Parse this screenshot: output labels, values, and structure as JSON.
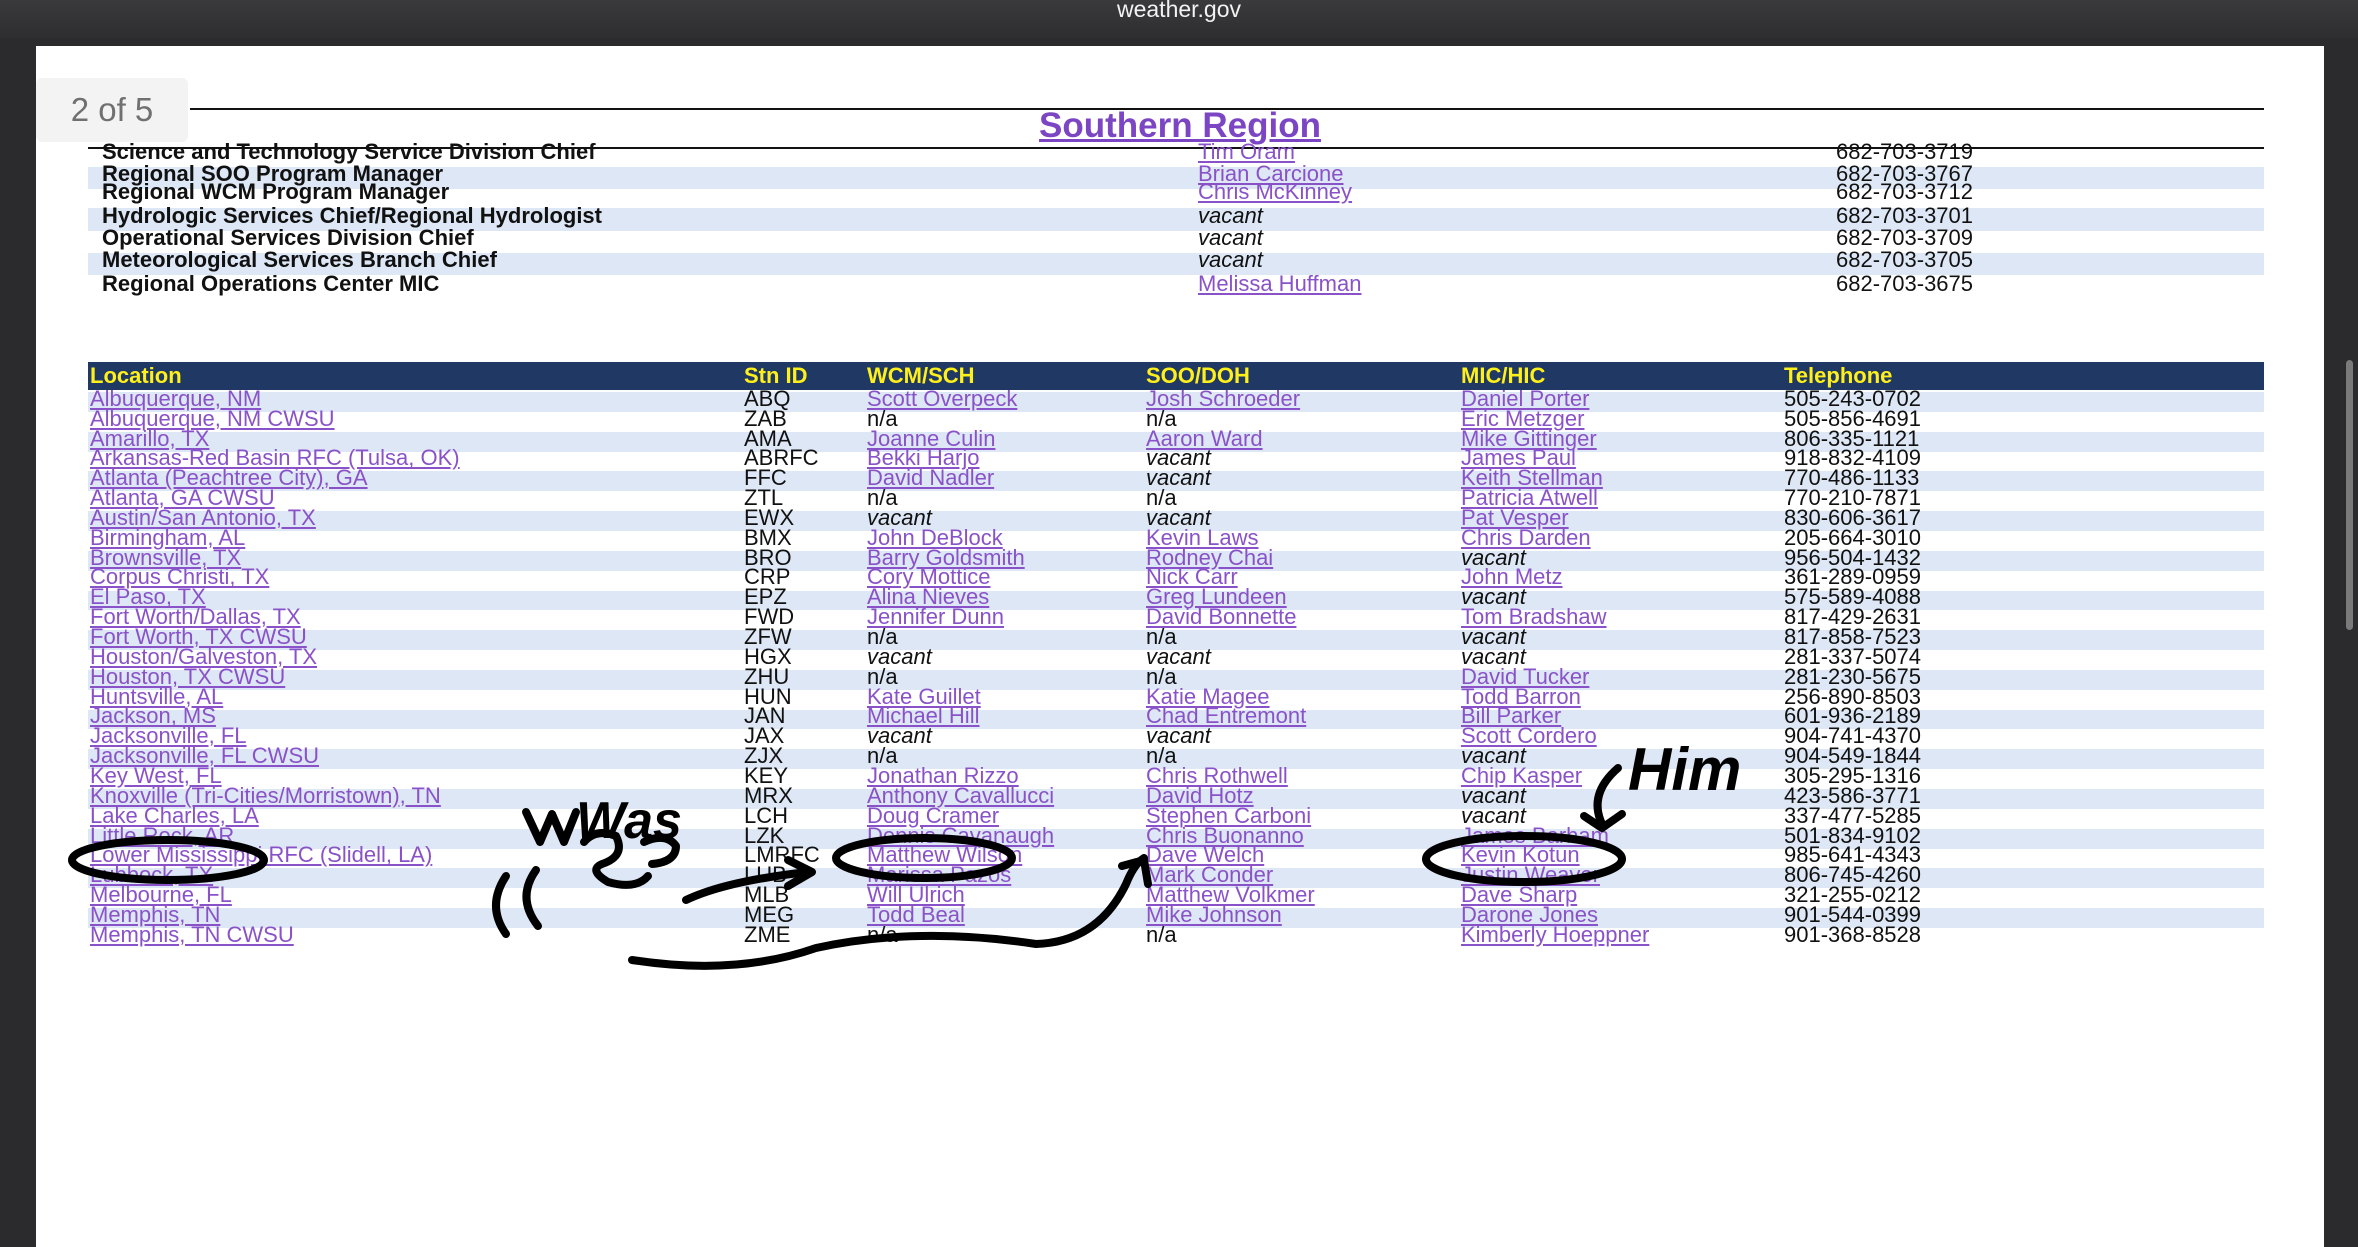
{
  "window": {
    "title": "weather.gov"
  },
  "document": {
    "page_indicator": "2 of 5",
    "region_title": "Southern Region"
  },
  "colors": {
    "link": "#8a52c8",
    "header_bg": "#1f3864",
    "header_text": "#ffef1a",
    "row_shade": "#dde7f5",
    "title": "#7b45c3",
    "annotation_ink": "#000000"
  },
  "staff": [
    {
      "title": "Science and Technology Service Division Chief",
      "name": "Tim Oram",
      "phone": "682-703-3719"
    },
    {
      "title": "Regional SOO Program Manager",
      "name": "Brian Carcione",
      "phone": "682-703-3767"
    },
    {
      "title": "Regional WCM Program Manager",
      "name": "Chris McKinney",
      "phone": "682-703-3712"
    },
    {
      "title": "Hydrologic Services Chief/Regional Hydrologist",
      "name": "vacant",
      "phone": "682-703-3701"
    },
    {
      "title": "Operational Services Division Chief",
      "name": "vacant",
      "phone": "682-703-3709"
    },
    {
      "title": "Meteorological Services Branch Chief",
      "name": "vacant",
      "phone": "682-703-3705"
    },
    {
      "title": "Regional Operations Center MIC",
      "name": "Melissa Huffman",
      "phone": "682-703-3675"
    }
  ],
  "table": {
    "headers": [
      "Location",
      "Stn ID",
      "WCM/SCH",
      "SOO/DOH",
      "MIC/HIC",
      "Telephone"
    ],
    "rows": [
      [
        "Albuquerque, NM",
        "ABQ",
        "Scott Overpeck",
        "Josh Schroeder",
        "Daniel Porter",
        "505-243-0702"
      ],
      [
        "Albuquerque, NM CWSU",
        "ZAB",
        "n/a",
        "n/a",
        "Eric Metzger",
        "505-856-4691"
      ],
      [
        "Amarillo, TX",
        "AMA",
        "Joanne Culin",
        "Aaron Ward",
        "Mike Gittinger",
        "806-335-1121"
      ],
      [
        "Arkansas-Red Basin RFC (Tulsa, OK)",
        "ABRFC",
        "Bekki Harjo",
        "vacant",
        "James Paul",
        "918-832-4109"
      ],
      [
        "Atlanta (Peachtree City), GA",
        "FFC",
        "David Nadler",
        "vacant",
        "Keith Stellman",
        "770-486-1133"
      ],
      [
        "Atlanta, GA CWSU",
        "ZTL",
        "n/a",
        "n/a",
        "Patricia Atwell",
        "770-210-7871"
      ],
      [
        "Austin/San Antonio, TX",
        "EWX",
        "vacant",
        "vacant",
        "Pat Vesper",
        "830-606-3617"
      ],
      [
        "Birmingham, AL",
        "BMX",
        "John DeBlock",
        "Kevin Laws",
        "Chris Darden",
        "205-664-3010"
      ],
      [
        "Brownsville, TX",
        "BRO",
        "Barry Goldsmith",
        "Rodney Chai",
        "vacant",
        "956-504-1432"
      ],
      [
        "Corpus Christi, TX",
        "CRP",
        "Cory Mottice",
        "Nick Carr",
        "John Metz",
        "361-289-0959"
      ],
      [
        "El Paso, TX",
        "EPZ",
        "Alina Nieves",
        "Greg Lundeen",
        "vacant",
        "575-589-4088"
      ],
      [
        "Fort Worth/Dallas, TX",
        "FWD",
        "Jennifer Dunn",
        "David Bonnette",
        "Tom Bradshaw",
        "817-429-2631"
      ],
      [
        "Fort Worth, TX CWSU",
        "ZFW",
        "n/a",
        "n/a",
        "vacant",
        "817-858-7523"
      ],
      [
        "Houston/Galveston, TX",
        "HGX",
        "vacant",
        "vacant",
        "vacant",
        "281-337-5074"
      ],
      [
        "Houston, TX CWSU",
        "ZHU",
        "n/a",
        "n/a",
        "David Tucker",
        "281-230-5675"
      ],
      [
        "Huntsville, AL",
        "HUN",
        "Kate Guillet",
        "Katie Magee",
        "Todd Barron",
        "256-890-8503"
      ],
      [
        "Jackson, MS",
        "JAN",
        "Michael Hill",
        "Chad Entremont",
        "Bill Parker",
        "601-936-2189"
      ],
      [
        "Jacksonville, FL",
        "JAX",
        "vacant",
        "vacant",
        "Scott Cordero",
        "904-741-4370"
      ],
      [
        "Jacksonville, FL CWSU",
        "ZJX",
        "n/a",
        "n/a",
        "vacant",
        "904-549-1844"
      ],
      [
        "Key West, FL",
        "KEY",
        "Jonathan Rizzo",
        "Chris Rothwell",
        "Chip Kasper",
        "305-295-1316"
      ],
      [
        "Knoxville (Tri-Cities/Morristown), TN",
        "MRX",
        "Anthony Cavallucci",
        "David Hotz",
        "vacant",
        "423-586-3771"
      ],
      [
        "Lake Charles, LA",
        "LCH",
        "Doug Cramer",
        "Stephen Carboni",
        "vacant",
        "337-477-5285"
      ],
      [
        "Little Rock, AR",
        "LZK",
        "Dennis Cavanaugh",
        "Chris Buonanno",
        "James Barham",
        "501-834-9102"
      ],
      [
        "Lower Mississippi RFC (Slidell, LA)",
        "LMRFC",
        "Matthew Wilson",
        "Dave Welch",
        "Kevin Kotun",
        "985-641-4343"
      ],
      [
        "Lubbock, TX",
        "LUB",
        "Marissa Pazos",
        "Mark Conder",
        "Justin Weaver",
        "806-745-4260"
      ],
      [
        "Melbourne, FL",
        "MLB",
        "Will Ulrich",
        "Matthew Volkmer",
        "Dave Sharp",
        "321-255-0212"
      ],
      [
        "Memphis, TN",
        "MEG",
        "Todd Beal",
        "Mike Johnson",
        "Darone Jones",
        "901-544-0399"
      ],
      [
        "Memphis, TN CWSU",
        "ZME",
        "n/a",
        "n/a",
        "Kimberly Hoeppner",
        "901-368-8528"
      ]
    ]
  },
  "annotations": {
    "was_label": "Was",
    "him_label": "Him"
  }
}
